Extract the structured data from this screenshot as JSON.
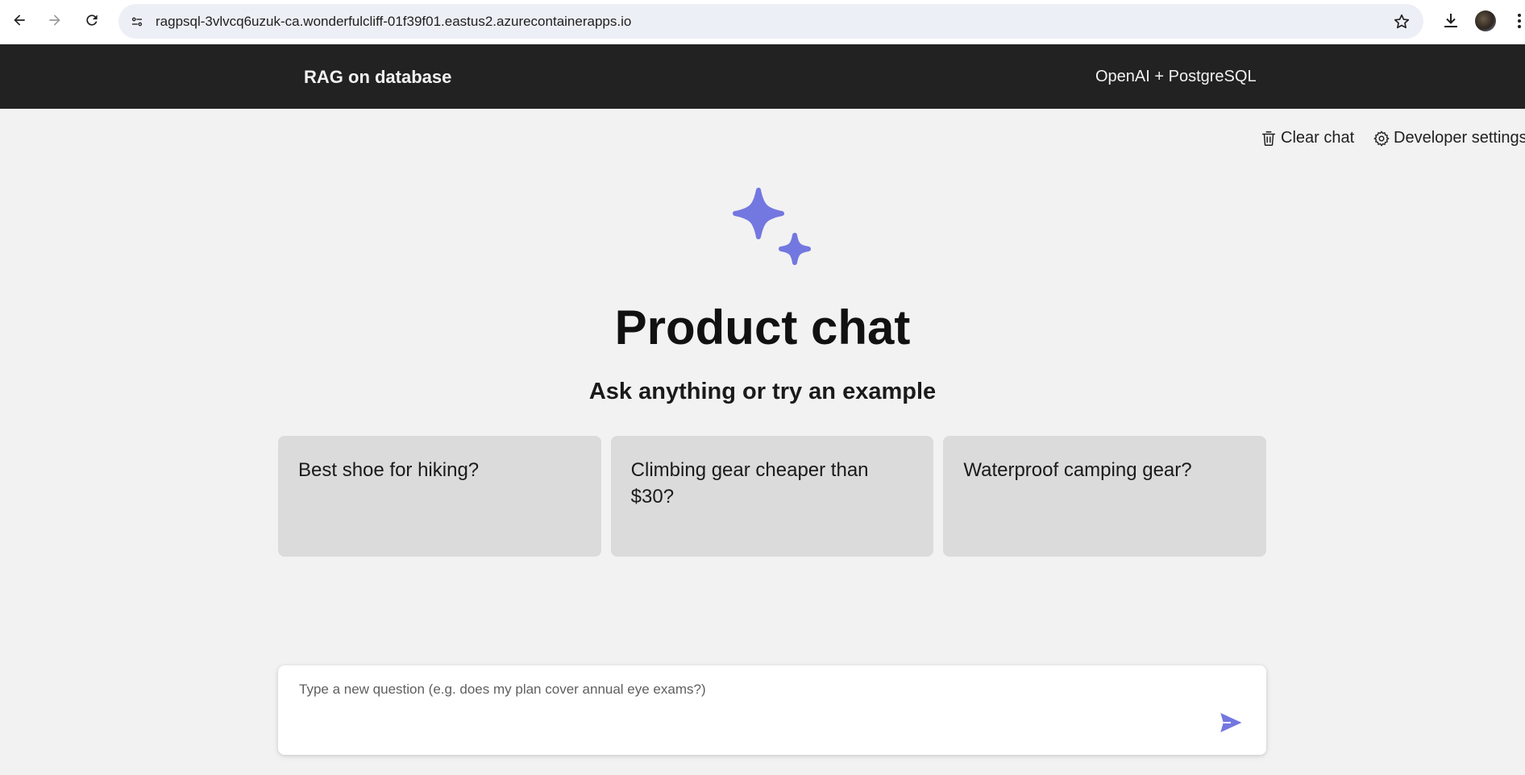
{
  "browser": {
    "url": "ragpsql-3vlvcq6uzuk-ca.wonderfulcliff-01f39f01.eastus2.azurecontainerapps.io",
    "icons": [
      "back-arrow-icon",
      "forward-arrow-icon",
      "reload-icon",
      "site-info-icon",
      "bookmark-star-icon",
      "download-icon",
      "profile-avatar",
      "more-options-icon"
    ]
  },
  "header": {
    "title": "RAG on database",
    "subtitle": "OpenAI + PostgreSQL"
  },
  "commands": {
    "clear_chat": "Clear chat",
    "developer_settings": "Developer settings"
  },
  "empty_state": {
    "title": "Product chat",
    "subtitle": "Ask anything or try an example",
    "examples": [
      "Best shoe for hiking?",
      "Climbing gear cheaper than $30?",
      "Waterproof camping gear?"
    ]
  },
  "question_input": {
    "placeholder": "Type a new question (e.g. does my plan cover annual eye exams?)",
    "value": ""
  },
  "colors": {
    "accent": "#7377e0",
    "header_bg": "#222222",
    "page_bg": "#f2f2f2",
    "card_bg": "#dbdbdb"
  }
}
